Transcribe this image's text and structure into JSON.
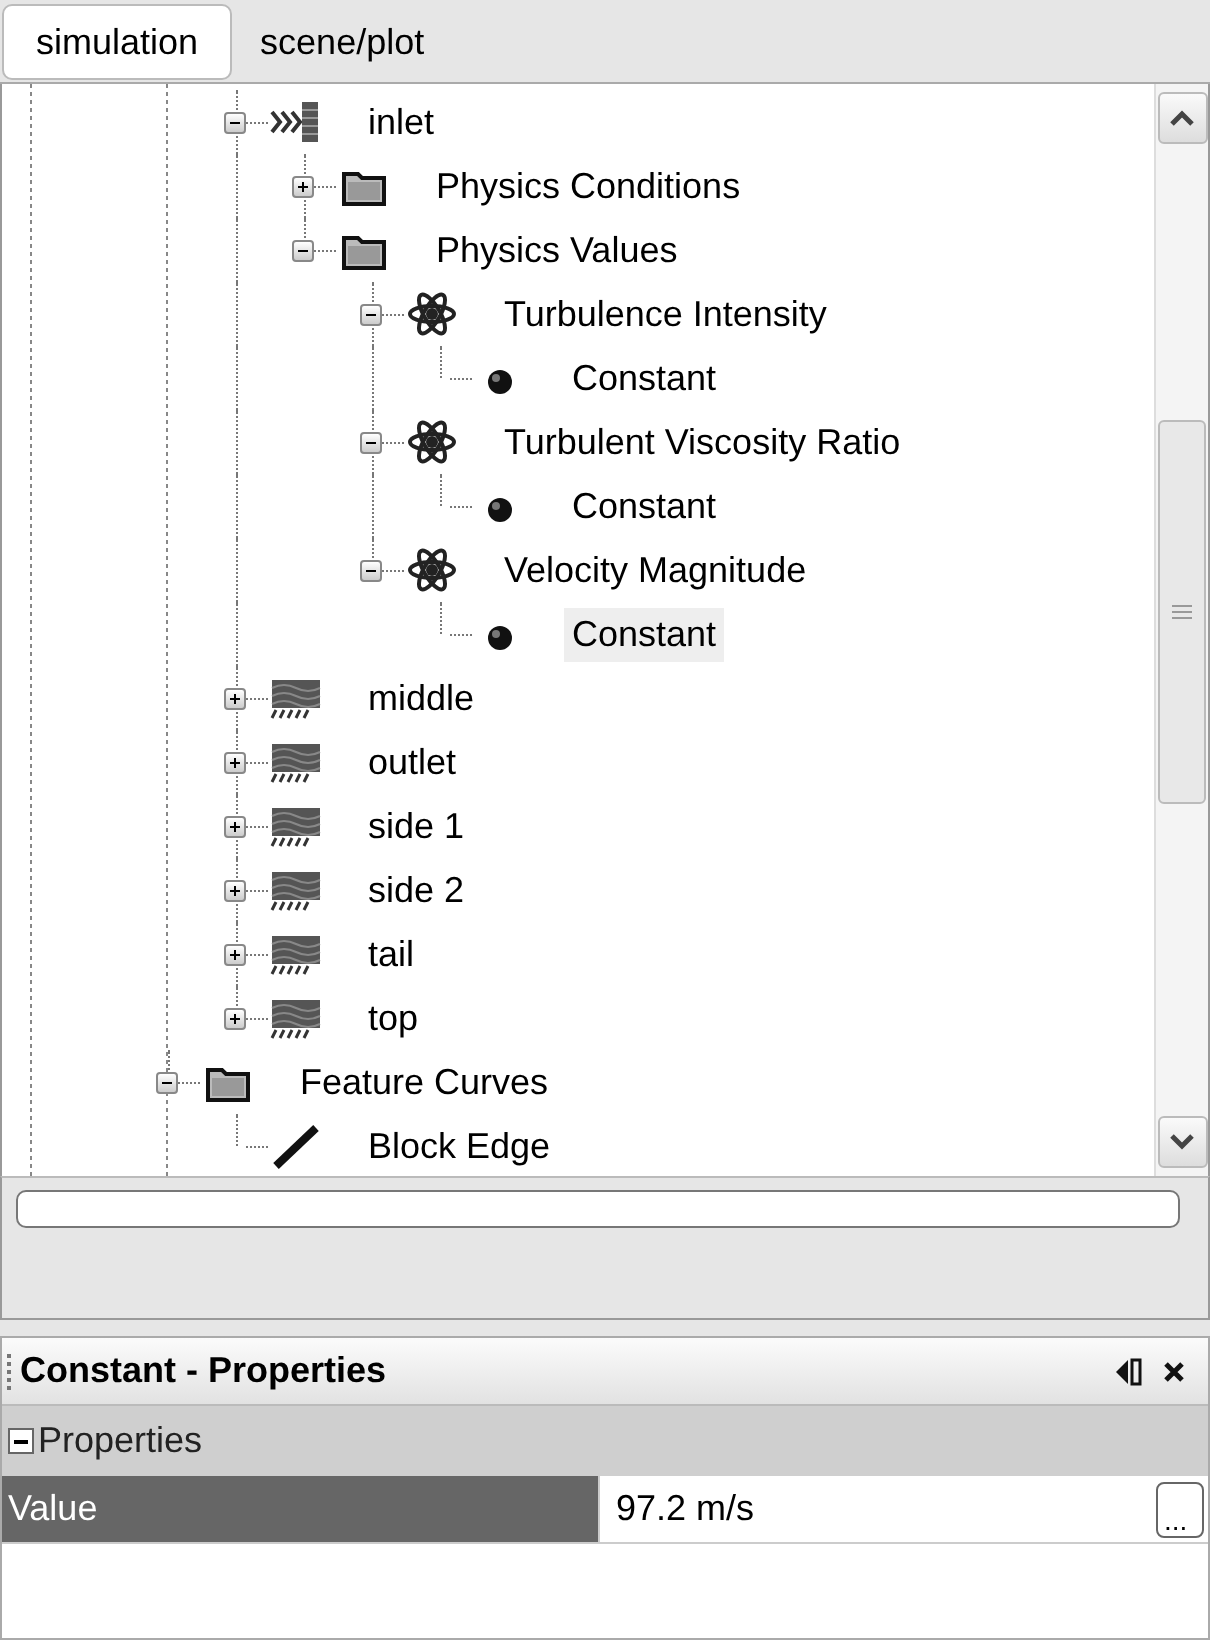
{
  "tabs": [
    {
      "label": "simulation",
      "selected": true
    },
    {
      "label": "scene/plot",
      "selected": false
    }
  ],
  "tree": {
    "items": [
      {
        "label": "inlet",
        "kind": "inlet",
        "expanded": true,
        "selected": false,
        "children": [
          {
            "label": "Physics Conditions",
            "kind": "folder",
            "expanded": false,
            "selected": false
          },
          {
            "label": "Physics Values",
            "kind": "folder",
            "expanded": true,
            "selected": false,
            "children": [
              {
                "label": "Turbulence Intensity",
                "kind": "physics",
                "expanded": true,
                "selected": false,
                "children": [
                  {
                    "label": "Constant",
                    "kind": "constant",
                    "selected": false
                  }
                ]
              },
              {
                "label": "Turbulent Viscosity Ratio",
                "kind": "physics",
                "expanded": true,
                "selected": false,
                "children": [
                  {
                    "label": "Constant",
                    "kind": "constant",
                    "selected": false
                  }
                ]
              },
              {
                "label": "Velocity Magnitude",
                "kind": "physics",
                "expanded": true,
                "selected": false,
                "children": [
                  {
                    "label": "Constant",
                    "kind": "constant",
                    "selected": true
                  }
                ]
              }
            ]
          }
        ]
      },
      {
        "label": "middle",
        "kind": "boundary",
        "expanded": false,
        "selected": false
      },
      {
        "label": "outlet",
        "kind": "boundary",
        "expanded": false,
        "selected": false
      },
      {
        "label": "side 1",
        "kind": "boundary",
        "expanded": false,
        "selected": false
      },
      {
        "label": "side 2",
        "kind": "boundary",
        "expanded": false,
        "selected": false
      },
      {
        "label": "tail",
        "kind": "boundary",
        "expanded": false,
        "selected": false
      },
      {
        "label": "top",
        "kind": "boundary",
        "expanded": false,
        "selected": false
      }
    ],
    "parent_level_items": [
      {
        "label": "Feature Curves",
        "kind": "folder",
        "expanded": true,
        "selected": false,
        "children": [
          {
            "label": "Block Edge",
            "kind": "edge",
            "selected": false
          }
        ]
      }
    ]
  },
  "progress": {
    "level": 0
  },
  "properties": {
    "title": "Constant - Properties",
    "section": {
      "label": "Properties",
      "expanded": true
    },
    "rows": [
      {
        "name": "Value",
        "value": "97.2 m/s",
        "button": "..."
      }
    ]
  }
}
